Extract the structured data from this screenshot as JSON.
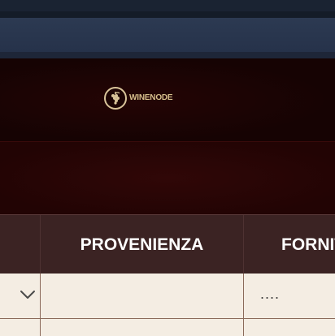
{
  "brand": {
    "name": "WINENODE",
    "icon": "grape-icon",
    "accent": "#d6bf8c"
  },
  "table": {
    "columns": [
      {
        "label": ""
      },
      {
        "label": "PROVENIENZA"
      },
      {
        "label": "FORNITORE"
      }
    ],
    "rows": [
      {
        "cells": [
          "",
          "",
          "...."
        ]
      }
    ]
  },
  "colors": {
    "header_bg": "#3b2323",
    "row_bg": "#f4ede3",
    "page_bg": "#2a0606"
  }
}
